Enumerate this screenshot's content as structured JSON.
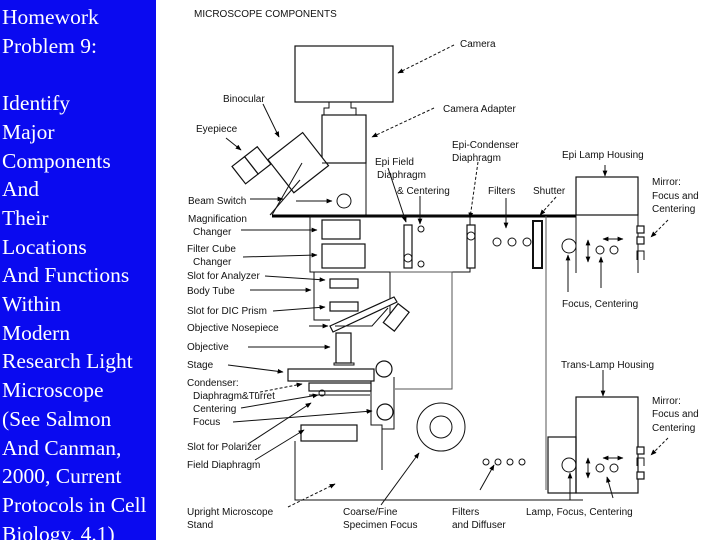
{
  "sidebar": {
    "background_color": "#0a0af0",
    "text_color": "#ffffff",
    "lines": [
      "Homework",
      "Problem 9:",
      "",
      "Identify",
      "Major",
      "Components",
      "And",
      "Their",
      "Locations",
      "And Functions",
      "Within",
      "Modern",
      "Research Light",
      "Microscope",
      "(See Salmon",
      "And Canman,",
      "2000, Current",
      "Protocols in Cell",
      "Biology, 4.1)"
    ]
  },
  "diagram": {
    "title": "MICROSCOPE COMPONENTS",
    "labels": {
      "camera": "Camera",
      "camera_adapter": "Camera Adapter",
      "binocular": "Binocular",
      "eyepiece": "Eyepiece",
      "epi_condenser_1": "Epi-Condenser",
      "epi_condenser_2": "Diaphragm",
      "epi_lamp_housing": "Epi Lamp Housing",
      "epi_field_1": "Epi Field",
      "epi_field_2": "Diaphragm",
      "epi_field_3": "& Centering",
      "filters_top": "Filters",
      "shutter": "Shutter",
      "mirror_top_1": "Mirror:",
      "mirror_top_2": "Focus and",
      "mirror_top_3": "Centering",
      "beam_switch": "Beam Switch",
      "magnification_1": "Magnification",
      "magnification_2": "Changer",
      "filter_cube_1": "Filter Cube",
      "filter_cube_2": "Changer",
      "slot_analyzer": "Slot for Analyzer",
      "body_tube": "Body Tube",
      "slot_dic": "Slot for DIC Prism",
      "nosepiece": "Objective Nosepiece",
      "objective": "Objective",
      "stage": "Stage",
      "condenser": "Condenser:",
      "diaphragm_turret": "Diaphragm&Turret",
      "centering": "Centering",
      "focus": "Focus",
      "slot_polarizer": "Slot for Polarizer",
      "field_diaphragm": "Field Diaphragm",
      "upright_stand_1": "Upright Microscope",
      "upright_stand_2": "Stand",
      "focus_centering": "Focus, Centering",
      "trans_lamp": "Trans-Lamp Housing",
      "mirror_bot_1": "Mirror:",
      "mirror_bot_2": "Focus and",
      "mirror_bot_3": "Centering",
      "coarse_fine_1": "Coarse/Fine",
      "coarse_fine_2": "Specimen Focus",
      "filters_diffuser_1": "Filters",
      "filters_diffuser_2": "and Diffuser",
      "lamp_focus": "Lamp, Focus, Centering"
    }
  }
}
